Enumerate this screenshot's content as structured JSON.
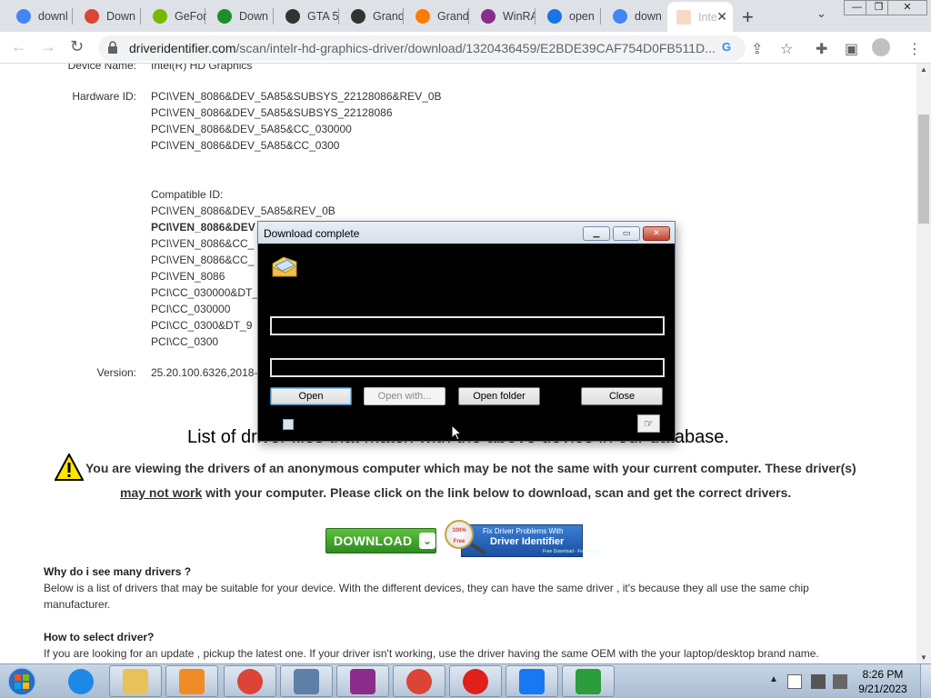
{
  "browser": {
    "tabs": [
      {
        "title": "downl",
        "icon": "google-icon"
      },
      {
        "title": "Down",
        "icon": "chrome-icon"
      },
      {
        "title": "GeFor",
        "icon": "nvidia-icon"
      },
      {
        "title": "Down",
        "icon": "play-icon"
      },
      {
        "title": "GTA 5",
        "icon": "gta-icon"
      },
      {
        "title": "Grand",
        "icon": "gta-icon"
      },
      {
        "title": "Grand",
        "icon": "flame-icon"
      },
      {
        "title": "WinRA",
        "icon": "winrar-icon"
      },
      {
        "title": "open",
        "icon": "search-icon"
      },
      {
        "title": "down",
        "icon": "google-icon"
      },
      {
        "title": "Inte",
        "icon": "page-icon"
      }
    ],
    "new_tab": "+",
    "url_host": "driveridentifier.com",
    "url_path": "/scan/intelr-hd-graphics-driver/download/1320436459/E2BDE39CAF754D0FB511D..."
  },
  "device": {
    "name_label": "Device Name:",
    "name_value": "Intel(R) HD Graphics",
    "hardware_label": "Hardware ID:",
    "hardware_ids": [
      "PCI\\VEN_8086&DEV_5A85&SUBSYS_22128086&REV_0B",
      "PCI\\VEN_8086&DEV_5A85&SUBSYS_22128086",
      "PCI\\VEN_8086&DEV_5A85&CC_030000",
      "PCI\\VEN_8086&DEV_5A85&CC_0300"
    ],
    "compatible_label": "Compatible ID:",
    "compatible_ids": [
      "PCI\\VEN_8086&DEV_5A85&REV_0B",
      "PCI\\VEN_8086&DEV",
      "PCI\\VEN_8086&CC_",
      "PCI\\VEN_8086&CC_",
      "PCI\\VEN_8086",
      "PCI\\CC_030000&DT_",
      "PCI\\CC_030000",
      "PCI\\CC_0300&DT_9",
      "PCI\\CC_0300"
    ],
    "version_label": "Version:",
    "version_value": "25.20.100.6326,2018-"
  },
  "content": {
    "list_title": "List of driver files that match with the above device in our database.",
    "warning_line1": "You are viewing the drivers of an anonymous computer which may be not the same with your current computer. These driver(s)",
    "warning_may_not_work": "may not work",
    "warning_line2": " with your computer. Please click on the link below to download, scan and get the correct drivers.",
    "download_label": "DOWNLOAD",
    "fix_banner_line1": "Fix Driver Problems With",
    "fix_banner_line2": "Driver Identifier",
    "fix_banner_line3": "Free Download - Free Scan",
    "fix_badge": "100% Free",
    "why_heading": "Why do i see many drivers ?",
    "why_text": "Below is a list of drivers that may be suitable for your device. With the different devices, they can have the same driver , it's because they all use the same chip manufacturer.",
    "how_heading": "How to select driver?",
    "how_text": "If you are looking for an update , pickup the latest one. If your driver isn't working, use the driver having the same OEM with the your laptop/desktop brand name."
  },
  "dialog": {
    "title": "Download complete",
    "open_label": "Open",
    "open_with_label": "Open with...",
    "open_folder_label": "Open folder",
    "close_label": "Close"
  },
  "taskbar": {
    "apps": [
      "ie-icon",
      "explorer-icon",
      "media-player-icon",
      "chrome-icon",
      "notepad-icon",
      "winrar-icon",
      "chrome-icon",
      "opera-icon",
      "facebook-icon",
      "idm-icon"
    ],
    "time": "8:26 PM",
    "date": "9/21/2023"
  }
}
